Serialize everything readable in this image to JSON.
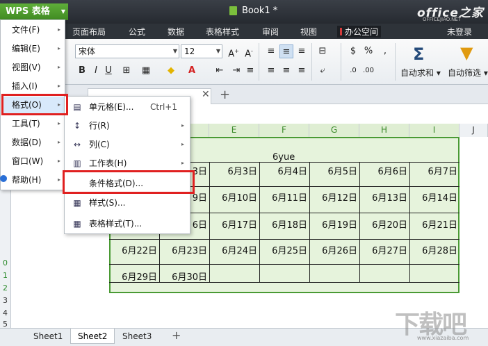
{
  "app": {
    "menu_button": "WPS 表格",
    "doc_title": "Book1 *",
    "watermark": "office之家",
    "watermark_sub": "OFFICEJIAO.NET",
    "login": "未登录"
  },
  "ribbon_tabs": [
    "页面布局",
    "公式",
    "数据",
    "表格样式",
    "审阅",
    "视图",
    "办公空间"
  ],
  "ribbon": {
    "font_name": "宋体",
    "font_size": "12",
    "bold": "B",
    "italic": "I",
    "underline": "U",
    "percent": "%",
    "comma": ",",
    "autosum_label": "自动求和",
    "autofilter_label": "自动筛选"
  },
  "columns": [
    "E",
    "F",
    "G",
    "H",
    "I",
    "J"
  ],
  "rows": [
    "0",
    "1",
    "2",
    "3",
    "4",
    "5"
  ],
  "sheet": {
    "title": "6yue",
    "cells": [
      [
        "3日",
        "6月3日",
        "6月4日",
        "6月5日",
        "6月6日",
        "6月7日"
      ],
      [
        "9日",
        "6月10日",
        "6月11日",
        "6月12日",
        "6月13日",
        "6月14日"
      ],
      [
        "6日",
        "6月17日",
        "6月18日",
        "6月19日",
        "6月20日",
        "6月21日"
      ],
      [
        "6月22日",
        "6月23日",
        "6月24日",
        "6月25日",
        "6月26日",
        "6月27日",
        "6月28日"
      ],
      [
        "6月29日",
        "6月30日"
      ]
    ]
  },
  "sheet_tabs": [
    "Sheet1",
    "Sheet2",
    "Sheet3"
  ],
  "main_menu": [
    {
      "label": "文件(F)"
    },
    {
      "label": "编辑(E)"
    },
    {
      "label": "视图(V)"
    },
    {
      "label": "插入(I)"
    },
    {
      "label": "格式(O)"
    },
    {
      "label": "工具(T)"
    },
    {
      "label": "数据(D)"
    },
    {
      "label": "窗口(W)"
    },
    {
      "label": "帮助(H)"
    }
  ],
  "format_submenu": [
    {
      "label": "单元格(E)...",
      "shortcut": "Ctrl+1",
      "icon": "cell-format-icon"
    },
    {
      "label": "行(R)",
      "icon": "row-icon"
    },
    {
      "label": "列(C)",
      "icon": "column-icon"
    },
    {
      "label": "工作表(H)",
      "icon": "worksheet-icon"
    },
    {
      "label": "条件格式(D)...",
      "icon": "conditional-format-icon"
    },
    {
      "label": "样式(S)...",
      "icon": "style-icon"
    },
    {
      "label": "表格样式(T)...",
      "icon": "table-style-icon"
    }
  ],
  "colors": {
    "accent_green": "#4a9a34",
    "selection_fill": "#e6f3dc",
    "highlight_red": "#e02020"
  }
}
